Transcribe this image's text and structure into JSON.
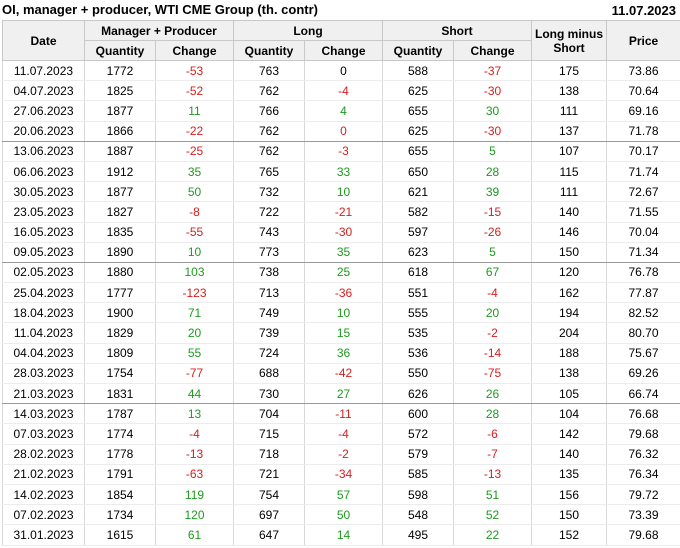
{
  "title": "OI, manager + producer, WTI CME Group (th. contr)",
  "report_date": "11.07.2023",
  "headers": {
    "date": "Date",
    "manager_producer": "Manager + Producer",
    "long": "Long",
    "short": "Short",
    "long_minus_short": "Long minus Short",
    "price": "Price",
    "quantity": "Quantity",
    "change": "Change"
  },
  "colors": {
    "negative": "#d42020",
    "positive": "#1f9a1f",
    "header_bg": "#f0f0f0"
  },
  "rows": [
    {
      "date": "11.07.2023",
      "mp_qty": "1772",
      "mp_chg": "-53",
      "long_qty": "763",
      "long_chg": "0",
      "short_qty": "588",
      "short_chg": "-37",
      "lms": "175",
      "price": "73.86"
    },
    {
      "date": "04.07.2023",
      "mp_qty": "1825",
      "mp_chg": "-52",
      "long_qty": "762",
      "long_chg": "-4",
      "short_qty": "625",
      "short_chg": "-30",
      "lms": "138",
      "price": "70.64"
    },
    {
      "date": "27.06.2023",
      "mp_qty": "1877",
      "mp_chg": "11",
      "long_qty": "766",
      "long_chg": "4",
      "short_qty": "655",
      "short_chg": "30",
      "lms": "111",
      "price": "69.16"
    },
    {
      "date": "20.06.2023",
      "mp_qty": "1866",
      "mp_chg": "-22",
      "long_qty": "762",
      "long_chg": "0",
      "short_qty": "625",
      "short_chg": "-30",
      "lms": "137",
      "price": "71.78",
      "sep": true
    },
    {
      "date": "13.06.2023",
      "mp_qty": "1887",
      "mp_chg": "-25",
      "long_qty": "762",
      "long_chg": "-3",
      "short_qty": "655",
      "short_chg": "5",
      "lms": "107",
      "price": "70.17"
    },
    {
      "date": "06.06.2023",
      "mp_qty": "1912",
      "mp_chg": "35",
      "long_qty": "765",
      "long_chg": "33",
      "short_qty": "650",
      "short_chg": "28",
      "lms": "115",
      "price": "71.74"
    },
    {
      "date": "30.05.2023",
      "mp_qty": "1877",
      "mp_chg": "50",
      "long_qty": "732",
      "long_chg": "10",
      "short_qty": "621",
      "short_chg": "39",
      "lms": "111",
      "price": "72.67"
    },
    {
      "date": "23.05.2023",
      "mp_qty": "1827",
      "mp_chg": "-8",
      "long_qty": "722",
      "long_chg": "-21",
      "short_qty": "582",
      "short_chg": "-15",
      "lms": "140",
      "price": "71.55"
    },
    {
      "date": "16.05.2023",
      "mp_qty": "1835",
      "mp_chg": "-55",
      "long_qty": "743",
      "long_chg": "-30",
      "short_qty": "597",
      "short_chg": "-26",
      "lms": "146",
      "price": "70.04"
    },
    {
      "date": "09.05.2023",
      "mp_qty": "1890",
      "mp_chg": "10",
      "long_qty": "773",
      "long_chg": "35",
      "short_qty": "623",
      "short_chg": "5",
      "lms": "150",
      "price": "71.34",
      "sep": true
    },
    {
      "date": "02.05.2023",
      "mp_qty": "1880",
      "mp_chg": "103",
      "long_qty": "738",
      "long_chg": "25",
      "short_qty": "618",
      "short_chg": "67",
      "lms": "120",
      "price": "76.78"
    },
    {
      "date": "25.04.2023",
      "mp_qty": "1777",
      "mp_chg": "-123",
      "long_qty": "713",
      "long_chg": "-36",
      "short_qty": "551",
      "short_chg": "-4",
      "lms": "162",
      "price": "77.87"
    },
    {
      "date": "18.04.2023",
      "mp_qty": "1900",
      "mp_chg": "71",
      "long_qty": "749",
      "long_chg": "10",
      "short_qty": "555",
      "short_chg": "20",
      "lms": "194",
      "price": "82.52"
    },
    {
      "date": "11.04.2023",
      "mp_qty": "1829",
      "mp_chg": "20",
      "long_qty": "739",
      "long_chg": "15",
      "short_qty": "535",
      "short_chg": "-2",
      "lms": "204",
      "price": "80.70"
    },
    {
      "date": "04.04.2023",
      "mp_qty": "1809",
      "mp_chg": "55",
      "long_qty": "724",
      "long_chg": "36",
      "short_qty": "536",
      "short_chg": "-14",
      "lms": "188",
      "price": "75.67"
    },
    {
      "date": "28.03.2023",
      "mp_qty": "1754",
      "mp_chg": "-77",
      "long_qty": "688",
      "long_chg": "-42",
      "short_qty": "550",
      "short_chg": "-75",
      "lms": "138",
      "price": "69.26"
    },
    {
      "date": "21.03.2023",
      "mp_qty": "1831",
      "mp_chg": "44",
      "long_qty": "730",
      "long_chg": "27",
      "short_qty": "626",
      "short_chg": "26",
      "lms": "105",
      "price": "66.74",
      "sep": true
    },
    {
      "date": "14.03.2023",
      "mp_qty": "1787",
      "mp_chg": "13",
      "long_qty": "704",
      "long_chg": "-11",
      "short_qty": "600",
      "short_chg": "28",
      "lms": "104",
      "price": "76.68"
    },
    {
      "date": "07.03.2023",
      "mp_qty": "1774",
      "mp_chg": "-4",
      "long_qty": "715",
      "long_chg": "-4",
      "short_qty": "572",
      "short_chg": "-6",
      "lms": "142",
      "price": "79.68"
    },
    {
      "date": "28.02.2023",
      "mp_qty": "1778",
      "mp_chg": "-13",
      "long_qty": "718",
      "long_chg": "-2",
      "short_qty": "579",
      "short_chg": "-7",
      "lms": "140",
      "price": "76.32"
    },
    {
      "date": "21.02.2023",
      "mp_qty": "1791",
      "mp_chg": "-63",
      "long_qty": "721",
      "long_chg": "-34",
      "short_qty": "585",
      "short_chg": "-13",
      "lms": "135",
      "price": "76.34"
    },
    {
      "date": "14.02.2023",
      "mp_qty": "1854",
      "mp_chg": "119",
      "long_qty": "754",
      "long_chg": "57",
      "short_qty": "598",
      "short_chg": "51",
      "lms": "156",
      "price": "79.72"
    },
    {
      "date": "07.02.2023",
      "mp_qty": "1734",
      "mp_chg": "120",
      "long_qty": "697",
      "long_chg": "50",
      "short_qty": "548",
      "short_chg": "52",
      "lms": "150",
      "price": "73.39"
    },
    {
      "date": "31.01.2023",
      "mp_qty": "1615",
      "mp_chg": "61",
      "long_qty": "647",
      "long_chg": "14",
      "short_qty": "495",
      "short_chg": "22",
      "lms": "152",
      "price": "79.68"
    }
  ]
}
